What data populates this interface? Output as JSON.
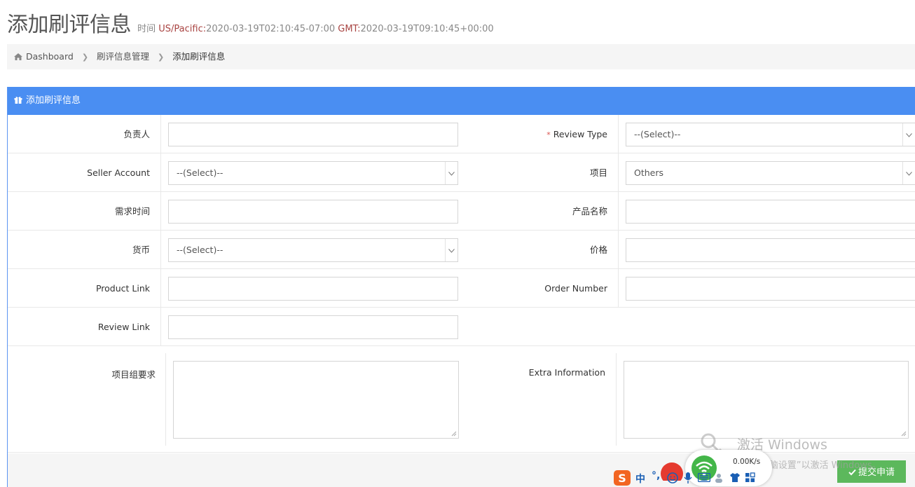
{
  "header": {
    "title": "添加刷评信息",
    "time_prefix": "时间",
    "tz1_key": "US/Pacific:",
    "tz1_value": "2020-03-19T02:10:45-07:00",
    "tz2_key": "GMT:",
    "tz2_value": "2020-03-19T09:10:45+00:00"
  },
  "breadcrumb": {
    "items": [
      "Dashboard",
      "刷评信息管理",
      "添加刷评信息"
    ]
  },
  "panel": {
    "title": "添加刷评信息"
  },
  "form": {
    "owner_label": "负责人",
    "owner_value": "",
    "review_type_label": "Review Type",
    "review_type_required": "*",
    "review_type_value": "--(Select)--",
    "seller_account_label": "Seller Account",
    "seller_account_value": "--(Select)--",
    "project_label": "项目",
    "project_value": "Others",
    "demand_time_label": "需求时间",
    "demand_time_value": "",
    "product_name_label": "产品名称",
    "product_name_value": "",
    "currency_label": "货币",
    "currency_value": "--(Select)--",
    "price_label": "价格",
    "price_value": "",
    "product_link_label": "Product Link",
    "product_link_value": "",
    "order_number_label": "Order Number",
    "order_number_value": "",
    "review_link_label": "Review Link",
    "review_link_value": "",
    "group_requirements_label": "项目组要求",
    "extra_info_label": "Extra Information"
  },
  "footer": {
    "submit_label": "提交申请"
  },
  "overlay": {
    "watermark_title": "激活 Windows",
    "watermark_sub": "转到“电脑设置”以激活 Windows。",
    "net_speed": "0.00K/s",
    "ime_lang": "中",
    "ime_punct": "°,"
  },
  "colors": {
    "panel_heading": "#4a8ef2",
    "submit": "#5cb85c",
    "required": "#d9534f",
    "timezone_key": "#a94442"
  },
  "icons": [
    "home-icon",
    "chevron-right-icon",
    "gift-icon",
    "chevron-down-icon",
    "resize-grip-icon",
    "check-icon",
    "key-icon",
    "sogou-icon",
    "emoji-icon",
    "mic-icon",
    "keyboard-icon",
    "shirt-icon",
    "grid-icon"
  ]
}
